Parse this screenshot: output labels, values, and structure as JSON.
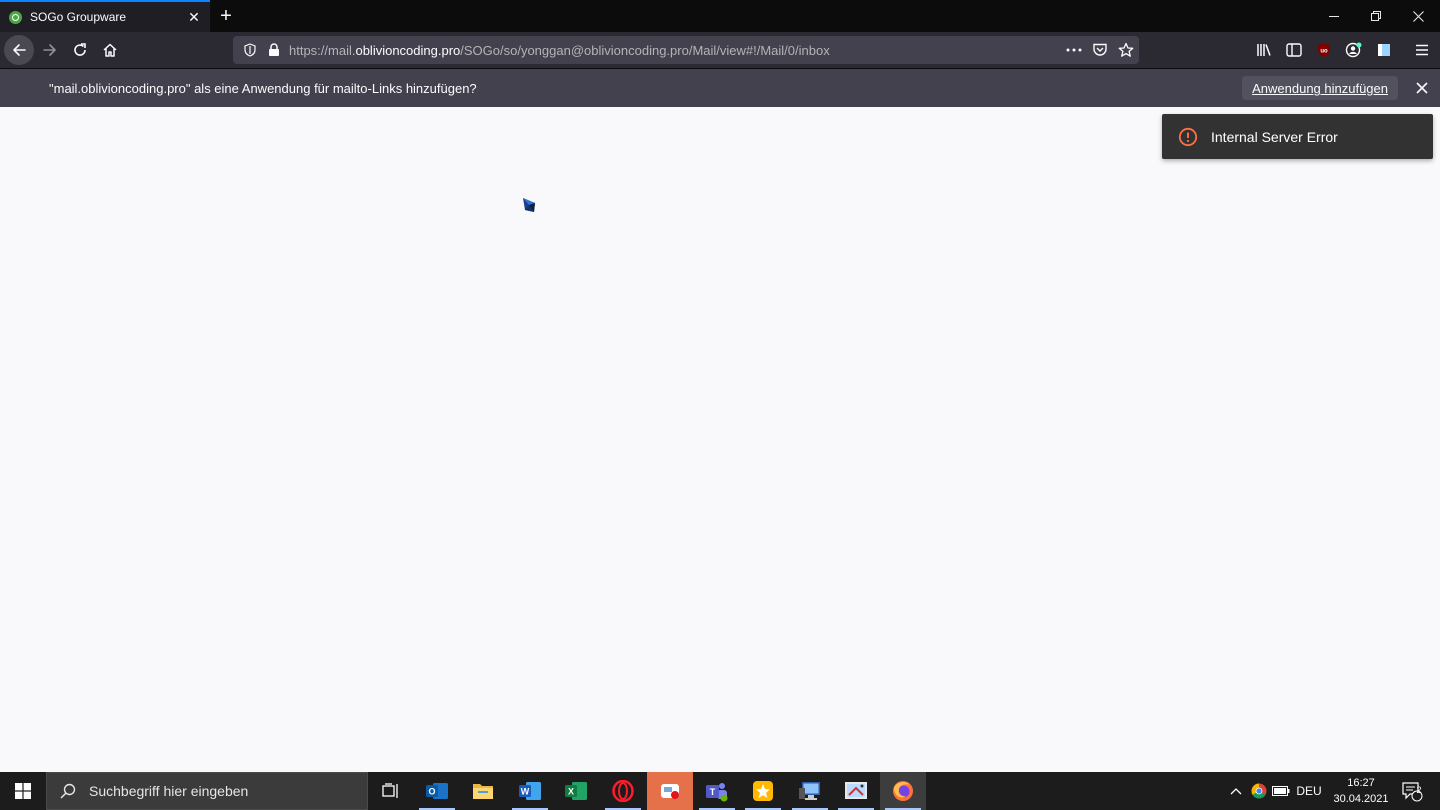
{
  "browser": {
    "tab": {
      "title": "SOGo Groupware",
      "close": "✕"
    },
    "new_tab": "+",
    "window_controls": {
      "minimize": "—",
      "restore": "❐",
      "close": "✕"
    },
    "url": {
      "prefix": "https://mail.",
      "host": "oblivioncoding.pro",
      "path": "/SOGo/so/yonggan@oblivioncoding.pro/Mail/view#!/Mail/0/inbox"
    },
    "notification": {
      "message": "\"mail.oblivioncoding.pro\" als eine Anwendung für mailto-Links hinzufügen?",
      "button": "Anwendung hinzufügen",
      "close": "✕"
    }
  },
  "page": {
    "toast": {
      "text": "Internal Server Error"
    }
  },
  "taskbar": {
    "search_placeholder": "Suchbegriff hier eingeben",
    "language": "DEU",
    "time": "16:27",
    "date": "30.04.2021",
    "notification_count": "2",
    "apps": [
      "task-view",
      "outlook",
      "file-explorer",
      "word",
      "excel",
      "opera",
      "video-editor",
      "teams",
      "sticky-app",
      "remote-desktop",
      "snipping-tool",
      "firefox"
    ]
  },
  "colors": {
    "accent": "#0a84ff",
    "toast_bg": "#323232",
    "error_icon": "#ff7043",
    "taskbar_bg": "#1c1c1c"
  }
}
